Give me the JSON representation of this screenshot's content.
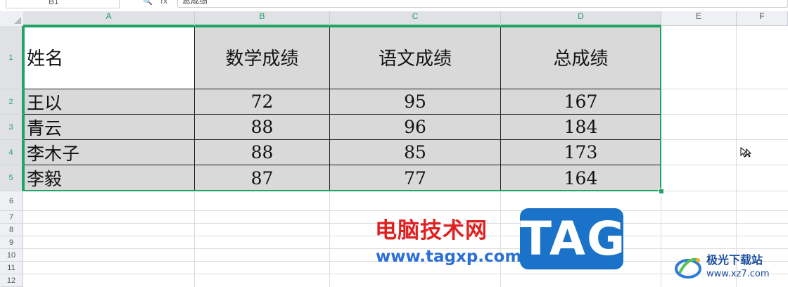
{
  "toolbar": {
    "name_box": "B1",
    "zoom_icon": "magnifier-icon",
    "fx": "fx",
    "formula_value": "总成绩"
  },
  "columns": [
    "A",
    "B",
    "C",
    "D",
    "E",
    "F"
  ],
  "rows": [
    "1",
    "2",
    "3",
    "4",
    "5",
    "6",
    "7",
    "8",
    "9",
    "10",
    "11",
    "12"
  ],
  "table": {
    "headers": [
      "姓名",
      "数学成绩",
      "语文成绩",
      "总成绩"
    ],
    "records": [
      [
        "王以",
        "72",
        "95",
        "167"
      ],
      [
        "青云",
        "88",
        "96",
        "184"
      ],
      [
        "李木子",
        "88",
        "85",
        "173"
      ],
      [
        "李毅",
        "87",
        "77",
        "164"
      ]
    ]
  },
  "colors": {
    "selection": "#21a366",
    "cell_fill": "#d9d9d9",
    "header_bg": "#eef0f4"
  },
  "watermark": {
    "site_cn": "电脑技术网",
    "site_url": "www.tagxp.com",
    "tag": "TAG",
    "brand_cn": "极光下载站",
    "brand_url": "www.xz7.com"
  },
  "cursor_icon": "hand-cursor-icon"
}
